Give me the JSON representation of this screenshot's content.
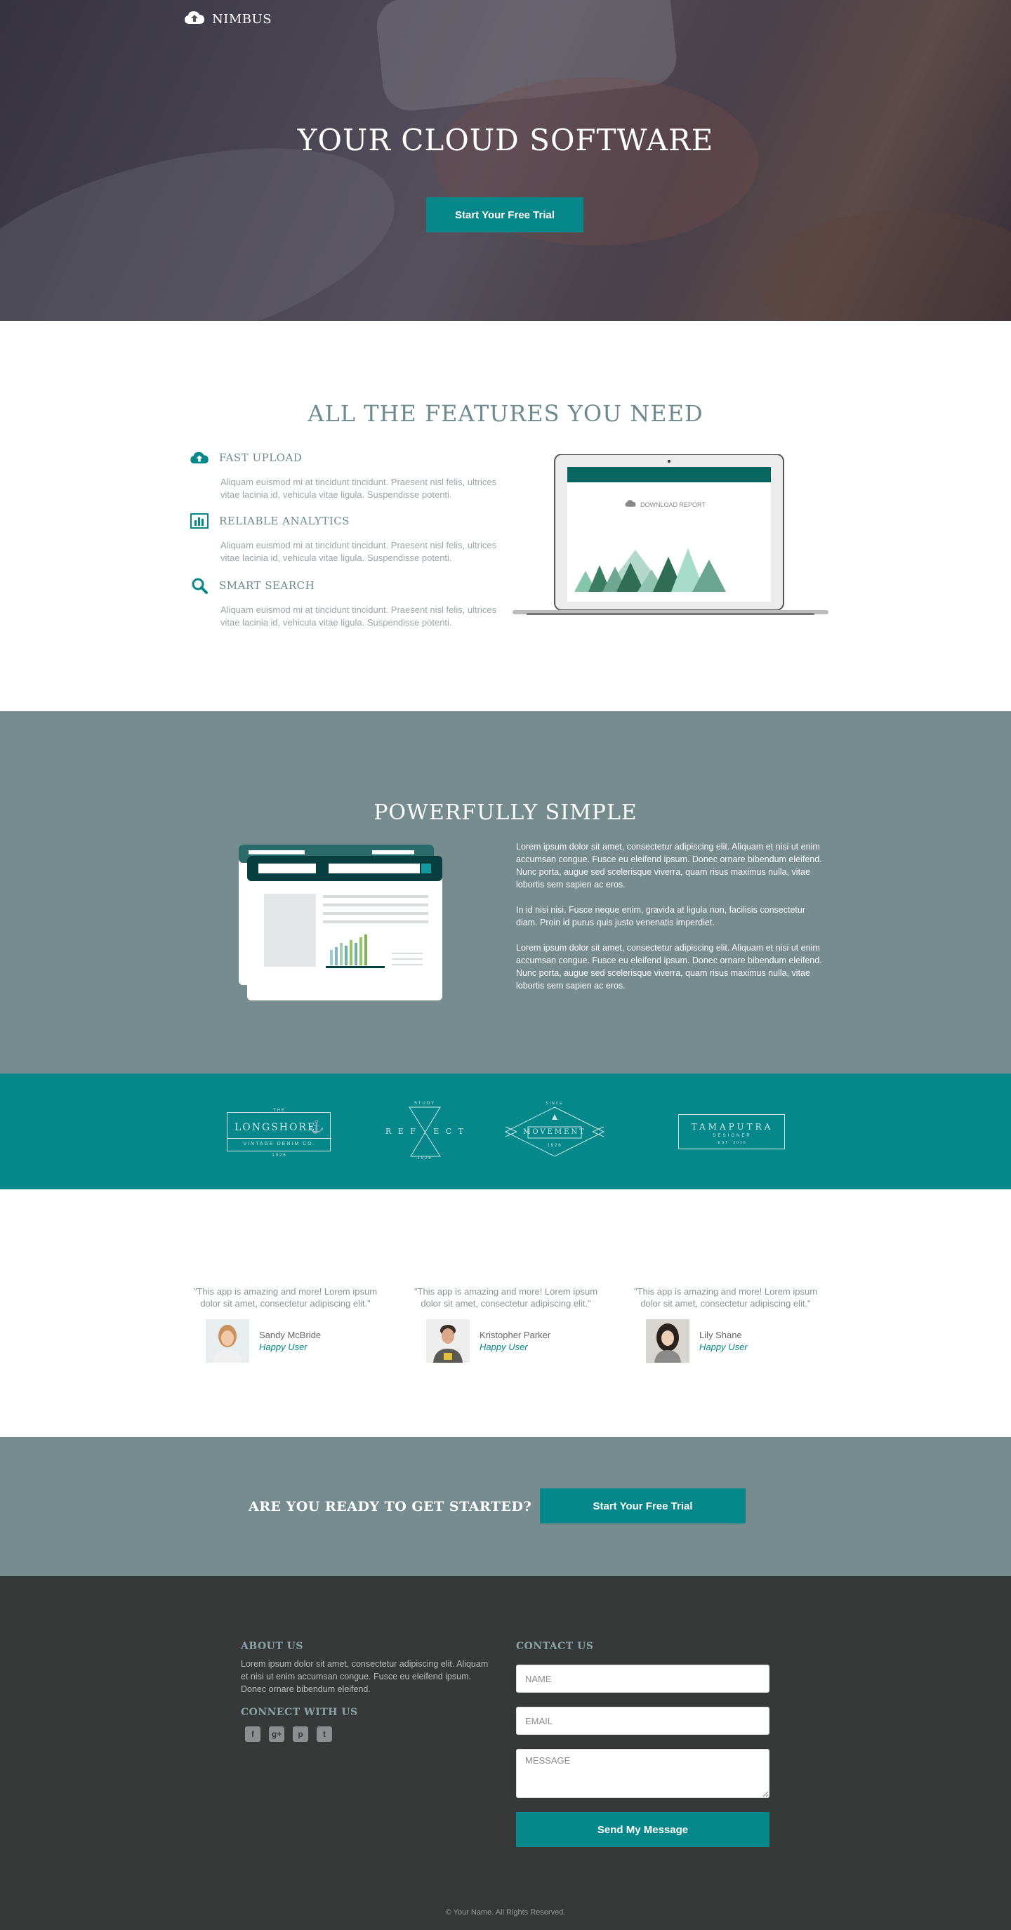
{
  "header": {
    "logo_text": "NIMBUS",
    "title": "YOUR CLOUD SOFTWARE",
    "cta_label": "Start Your Free Trial"
  },
  "features": {
    "title": "ALL THE FEATURES YOU NEED",
    "items": [
      {
        "icon": "cloud-upload-icon",
        "title": "FAST UPLOAD",
        "text": "Aliquam euismod mi at tincidunt tincidunt. Praesent nisl felis, ultrices vitae lacinia id, vehicula vitae ligula. Suspendisse potenti."
      },
      {
        "icon": "bar-chart-icon",
        "title": "RELIABLE ANALYTICS",
        "text": "Aliquam euismod mi at tincidunt tincidunt. Praesent nisl felis, ultrices vitae lacinia id, vehicula vitae ligula. Suspendisse potenti."
      },
      {
        "icon": "search-icon",
        "title": "SMART SEARCH",
        "text": "Aliquam euismod mi at tincidunt tincidunt. Praesent nisl felis, ultrices vitae lacinia id, vehicula vitae ligula. Suspendisse potenti."
      }
    ],
    "laptop_screen_label": "DOWNLOAD REPORT"
  },
  "simple": {
    "title": "POWERFULLY SIMPLE",
    "paragraphs": [
      "Lorem ipsum dolor sit amet, consectetur adipiscing elit. Aliquam et nisi ut enim accumsan congue. Fusce eu eleifend ipsum. Donec ornare bibendum eleifend. Nunc porta, augue sed scelerisque viverra, quam risus maximus nulla, vitae lobortis sem sapien ac eros.",
      "In id nisi nisi. Fusce neque enim, gravida at ligula non, facilisis consectetur diam. Proin id purus quis justo venenatis imperdiet.",
      "Lorem ipsum dolor sit amet, consectetur adipiscing elit. Aliquam et nisi ut enim accumsan congue. Fusce eu eleifend ipsum. Donec ornare bibendum eleifend. Nunc porta, augue sed scelerisque viverra, quam risus maximus nulla, vitae lobortis sem sapien ac eros."
    ]
  },
  "brands": {
    "longshore": {
      "top": "THE",
      "name": "LONGSHORE",
      "sub": "VINTAGE DENIM CO.",
      "year": "1926"
    },
    "reflect": {
      "top": "STUDY",
      "left": "R E F",
      "right": "E C T",
      "bottom": "1926"
    },
    "movement": {
      "top": "SINCE",
      "name": "MOVEMENT",
      "year": "1926"
    },
    "tamaputra": {
      "name": "TAMAPUTRA",
      "sub": "DESIGNER",
      "year": "EST. 2016"
    }
  },
  "testimonials": [
    {
      "quote": "\"This app is amazing and more! Lorem ipsum dolor sit amet, consectetur adipiscing elit.\"",
      "name": "Sandy McBride",
      "role": "Happy User"
    },
    {
      "quote": "\"This app is amazing and more! Lorem ipsum dolor sit amet, consectetur adipiscing elit.\"",
      "name": "Kristopher Parker",
      "role": "Happy User"
    },
    {
      "quote": "\"This app is amazing and more! Lorem ipsum dolor sit amet, consectetur adipiscing elit.\"",
      "name": "Lily Shane",
      "role": "Happy User"
    }
  ],
  "cta": {
    "text": "ARE YOU READY TO GET STARTED?",
    "button_label": "Start Your Free Trial"
  },
  "footer": {
    "about_title": "ABOUT US",
    "about_text": "Lorem ipsum dolor sit amet, consectetur adipiscing elit. Aliquam et nisi ut enim accumsan congue. Fusce eu eleifend ipsum. Donec ornare bibendum eleifend.",
    "connect_title": "CONNECT WITH US",
    "social": [
      {
        "icon": "facebook-icon",
        "glyph": "f"
      },
      {
        "icon": "google-plus-icon",
        "glyph": "g+"
      },
      {
        "icon": "pinterest-icon",
        "glyph": "p"
      },
      {
        "icon": "twitter-icon",
        "glyph": "t"
      }
    ],
    "contact_title": "CONTACT US",
    "name_placeholder": "NAME",
    "email_placeholder": "EMAIL",
    "message_placeholder": "MESSAGE",
    "send_label": "Send My Message",
    "copyright": "© Your Name. All Rights Reserved."
  },
  "colors": {
    "accent": "#06878a",
    "slate": "#768c8f",
    "footer_bg": "#373938",
    "heading": "#6f8a8e"
  }
}
